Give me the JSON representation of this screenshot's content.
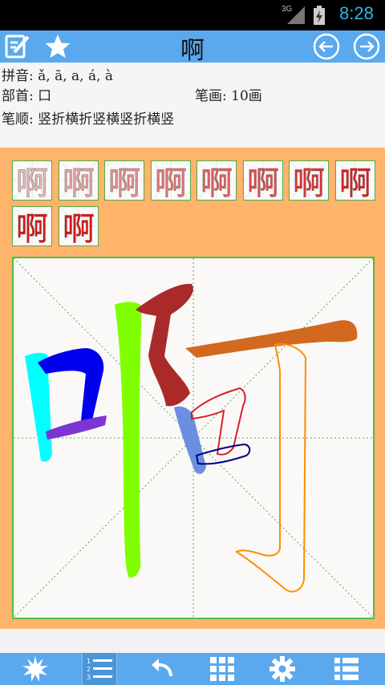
{
  "status_bar": {
    "network": "3G",
    "time": "8:28"
  },
  "toolbar": {
    "title": "啊",
    "icons": {
      "edit": "edit-note-icon",
      "favorite": "star-icon",
      "prev": "arrow-left-circle-icon",
      "next": "arrow-right-circle-icon"
    }
  },
  "info": {
    "pinyin": "拼音: ǎ, ā, a, á, à",
    "radical": "部首: 口",
    "strokes": "笔画: 10画",
    "stroke_order": "笔顺: 竖折横折竖横竖折横竖"
  },
  "thumbnails": [
    {
      "char": "啊",
      "highlight_stroke": 1
    },
    {
      "char": "啊",
      "highlight_stroke": 2
    },
    {
      "char": "啊",
      "highlight_stroke": 3
    },
    {
      "char": "啊",
      "highlight_stroke": 4
    },
    {
      "char": "啊",
      "highlight_stroke": 5
    },
    {
      "char": "啊",
      "highlight_stroke": 6
    },
    {
      "char": "啊",
      "highlight_stroke": 7
    },
    {
      "char": "啊",
      "highlight_stroke": 8
    },
    {
      "char": "啊",
      "highlight_stroke": 9
    },
    {
      "char": "啊",
      "highlight_stroke": 10
    }
  ],
  "board": {
    "character": "啊",
    "stroke_colors": [
      "#00ffff",
      "#0000ee",
      "#7b35d4",
      "#80ff00",
      "#aa2a2a",
      "#6b8fe0",
      "#d6202c",
      "#00008b",
      "#d2691e",
      "#ff8c00"
    ]
  },
  "bottom_bar": {
    "icons": [
      "burst-icon",
      "numbered-list-icon",
      "undo-icon",
      "grid-icon",
      "gear-icon",
      "list-icon"
    ]
  }
}
